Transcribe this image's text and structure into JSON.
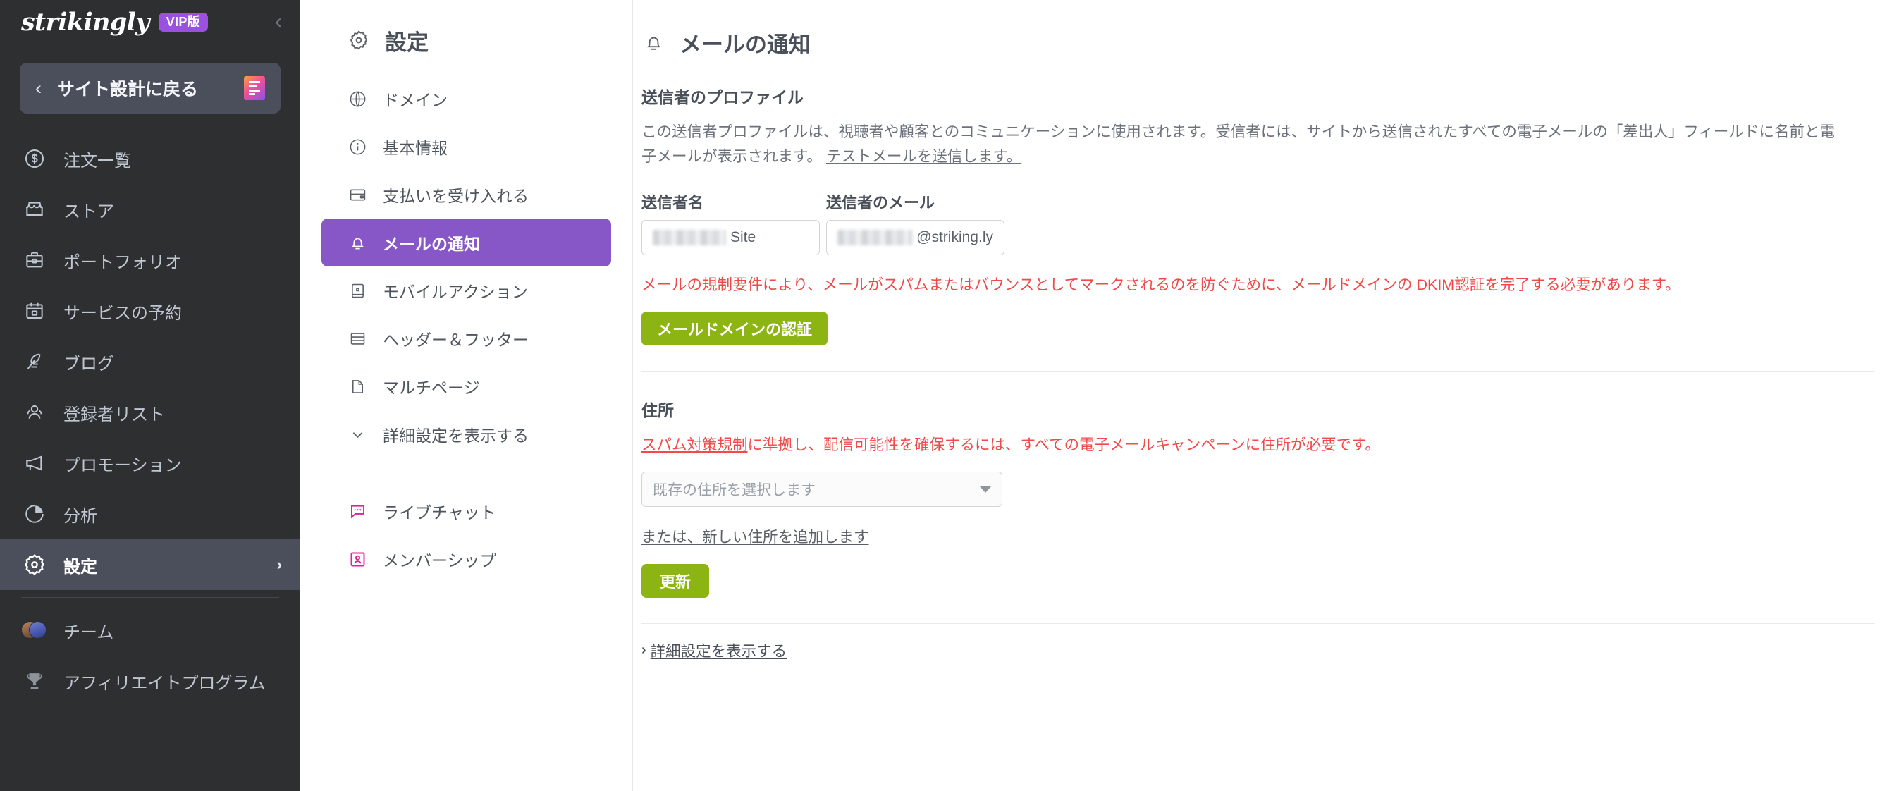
{
  "sidebar": {
    "logo": "strikingly",
    "vip_badge": "VIP版",
    "collapse_icon": "chevron-left-icon",
    "back_button": {
      "label": "サイト設計に戻る",
      "chevron": "‹",
      "icon": "site-designer-icon"
    },
    "items": [
      {
        "label": "注文一覧",
        "icon": "dollar-circle-icon",
        "active": false
      },
      {
        "label": "ストア",
        "icon": "store-icon",
        "active": false
      },
      {
        "label": "ポートフォリオ",
        "icon": "briefcase-icon",
        "active": false
      },
      {
        "label": "サービスの予約",
        "icon": "calendar-icon",
        "active": false
      },
      {
        "label": "ブログ",
        "icon": "quill-pen-icon",
        "active": false
      },
      {
        "label": "登録者リスト",
        "icon": "users-icon",
        "active": false
      },
      {
        "label": "プロモーション",
        "icon": "megaphone-icon",
        "active": false
      },
      {
        "label": "分析",
        "icon": "pie-chart-icon",
        "active": false
      },
      {
        "label": "設定",
        "icon": "gear-icon",
        "active": true,
        "chevron": "›"
      }
    ],
    "footer_items": [
      {
        "label": "チーム",
        "icon": "team-avatars-icon"
      },
      {
        "label": "アフィリエイトプログラム",
        "icon": "trophy-icon"
      }
    ]
  },
  "subnav": {
    "title": "設定",
    "title_icon": "gear-icon",
    "items": [
      {
        "label": "ドメイン",
        "icon": "globe-icon",
        "active": false
      },
      {
        "label": "基本情報",
        "icon": "info-circle-icon",
        "active": false
      },
      {
        "label": "支払いを受け入れる",
        "icon": "card-icon",
        "active": false
      },
      {
        "label": "メールの通知",
        "icon": "bell-icon",
        "active": true
      },
      {
        "label": "モバイルアクション",
        "icon": "mobile-icon",
        "active": false
      },
      {
        "label": "ヘッダー＆フッター",
        "icon": "layout-rows-icon",
        "active": false
      },
      {
        "label": "マルチページ",
        "icon": "page-icon",
        "active": false
      },
      {
        "label": "詳細設定を表示する",
        "icon": "chevron-down-icon",
        "active": false
      }
    ],
    "bottom_items": [
      {
        "label": "ライブチャット",
        "icon": "chat-bubble-icon"
      },
      {
        "label": "メンバーシップ",
        "icon": "member-card-icon"
      }
    ]
  },
  "main": {
    "title": "メールの通知",
    "title_icon": "bell-icon",
    "sender_profile": {
      "heading": "送信者のプロファイル",
      "description": "この送信者プロファイルは、視聴者や顧客とのコミュニケーションに使用されます。受信者には、サイトから送信されたすべての電子メールの「差出人」フィールドに名前と電子メールが表示されます。",
      "test_mail_link": "テストメールを送信します。",
      "sender_name_label": "送信者名",
      "sender_name_value_suffix": "Site",
      "sender_email_label": "送信者のメール",
      "sender_email_value_suffix": "@striking.ly",
      "dkim_warning": "メールの規制要件により、メールがスパムまたはバウンスとしてマークされるのを防ぐために、メールドメインの DKIM認証を完了する必要があります。",
      "verify_button": "メールドメインの認証"
    },
    "address": {
      "heading": "住所",
      "notice_link": "スパム対策規制",
      "notice_rest": "に準拠し、配信可能性を確保するには、すべての電子メールキャンペーンに住所が必要です。",
      "select_placeholder": "既存の住所を選択します",
      "add_new_link": "または、新しい住所を追加します",
      "update_button": "更新"
    },
    "advanced": {
      "arrow": "›",
      "label": "詳細設定を表示する"
    }
  },
  "colors": {
    "sidebar_bg": "#2e2f31",
    "sidebar_active": "#4b4f5c",
    "vip_purple": "#9b51e0",
    "subnav_active": "#8757c8",
    "green_button": "#8cb514",
    "warning_red": "#ef4a4a",
    "text_dark": "#4a5059"
  }
}
